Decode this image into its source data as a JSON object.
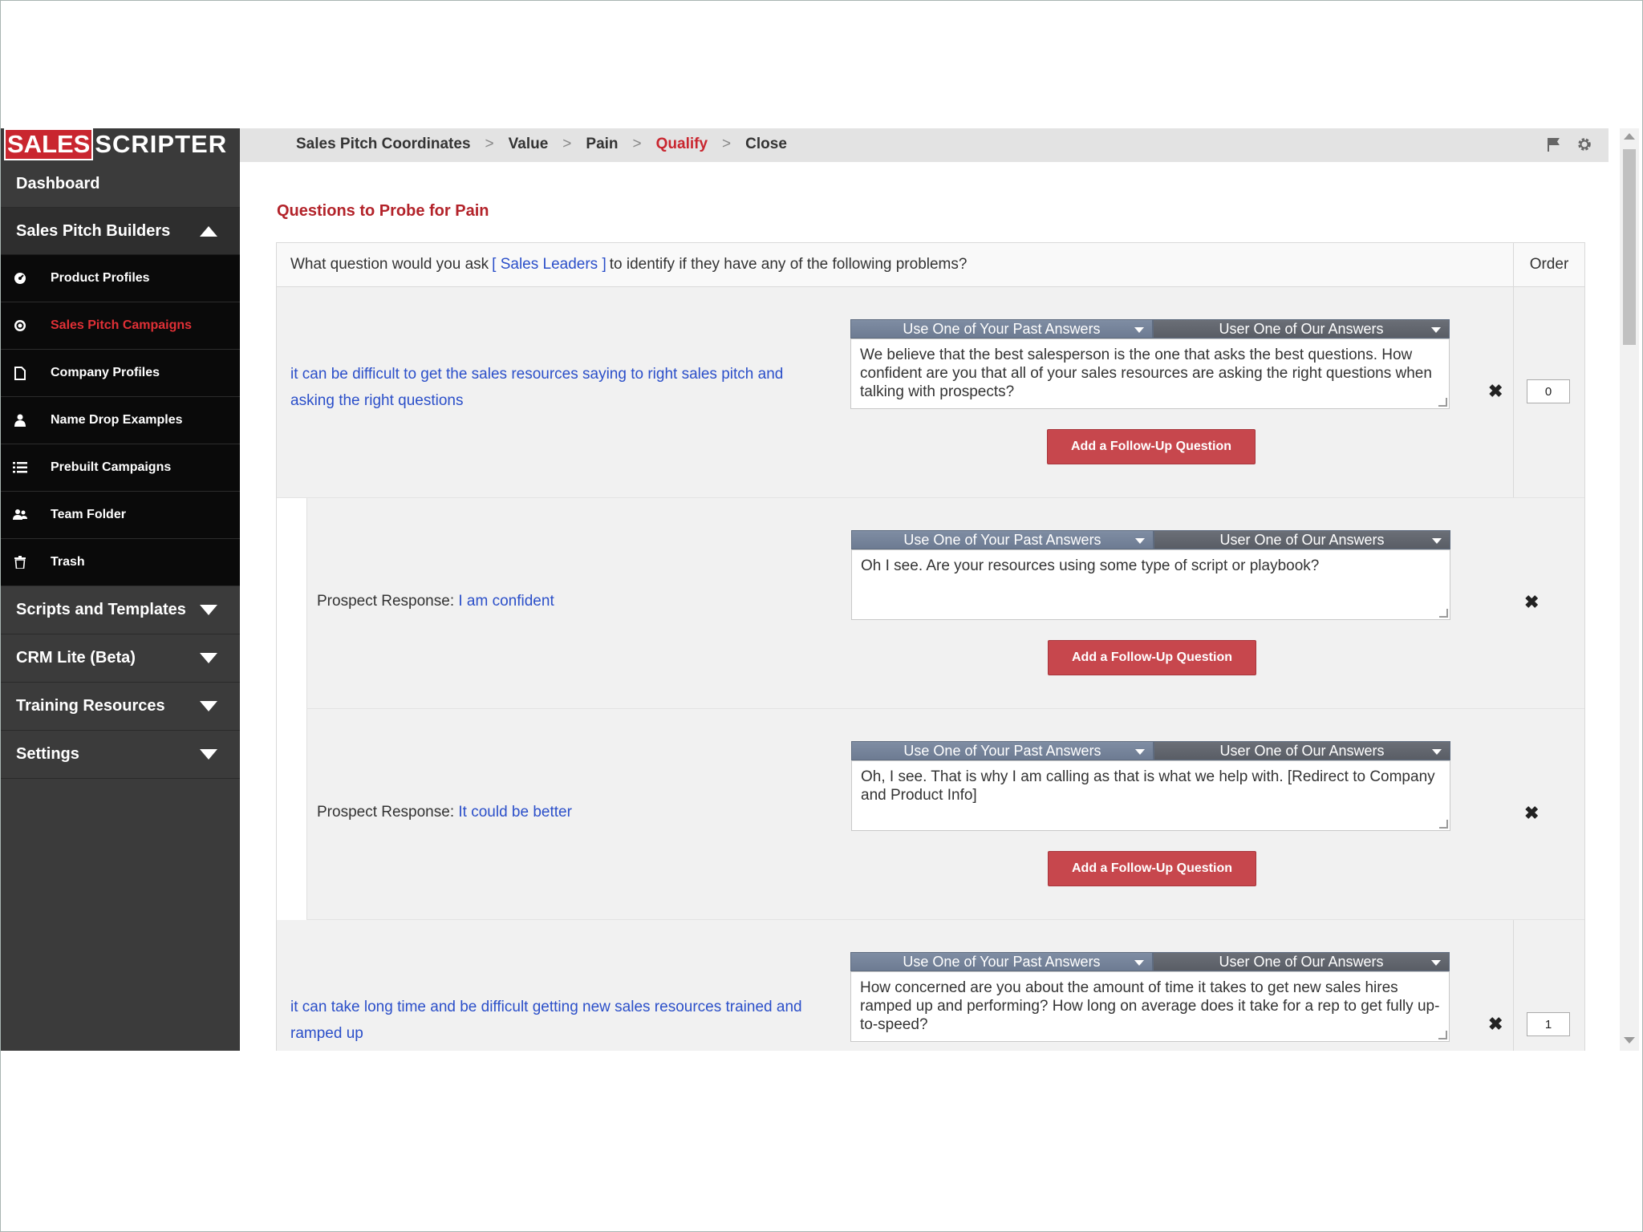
{
  "brand": {
    "part1": "SALES",
    "part2": "SCRIPTER",
    "red": "#c9262f"
  },
  "sidebar": {
    "dashboard": "Dashboard",
    "builders": "Sales Pitch Builders",
    "items": [
      {
        "label": "Product Profiles",
        "icon": "dashboard-gauge-icon",
        "active": false
      },
      {
        "label": "Sales Pitch Campaigns",
        "icon": "target-icon",
        "active": true
      },
      {
        "label": "Company Profiles",
        "icon": "document-icon",
        "active": false
      },
      {
        "label": "Name Drop Examples",
        "icon": "user-icon",
        "active": false
      },
      {
        "label": "Prebuilt Campaigns",
        "icon": "list-icon",
        "active": false
      },
      {
        "label": "Team Folder",
        "icon": "users-icon",
        "active": false
      },
      {
        "label": "Trash",
        "icon": "trash-icon",
        "active": false
      }
    ],
    "sections": [
      "Scripts and Templates",
      "CRM Lite (Beta)",
      "Training Resources",
      "Settings"
    ]
  },
  "breadcrumb": [
    "Sales Pitch Coordinates",
    "Value",
    "Pain",
    "Qualify",
    "Close"
  ],
  "breadcrumb_current": "Qualify",
  "page": {
    "title": "Questions to Probe for Pain",
    "header_prefix": "What question would you ask",
    "header_persona": "[ Sales Leaders ]",
    "header_suffix": "to identify if they have any of the following problems?",
    "order_header": "Order"
  },
  "dropdowns": {
    "past": "Use One of Your Past Answers",
    "ours": "User One of Our Answers"
  },
  "add_button": "Add a Follow-Up Question",
  "response_label": "Prospect Response:",
  "rows": [
    {
      "problem": "it can be difficult to get the sales resources saying to right sales pitch and asking the right questions",
      "answer": "We believe that the best salesperson is the one that asks the best questions. How confident are you that all of your sales resources are asking the right questions when talking with prospects?",
      "order": "0"
    },
    {
      "response": "I am confident",
      "answer": "Oh I see. Are your resources using some type of script or playbook?"
    },
    {
      "response": "It could be better",
      "answer": "Oh, I see. That is why I am calling as that is what we help with. [Redirect to Company and Product Info]"
    },
    {
      "problem": "it can take long time and be difficult getting new sales resources trained and ramped up",
      "answer": "How concerned are you about the amount of time it takes to get new sales hires ramped up and performing? How long on average does it take for a rep to get fully up-to-speed?",
      "order": "1"
    }
  ]
}
